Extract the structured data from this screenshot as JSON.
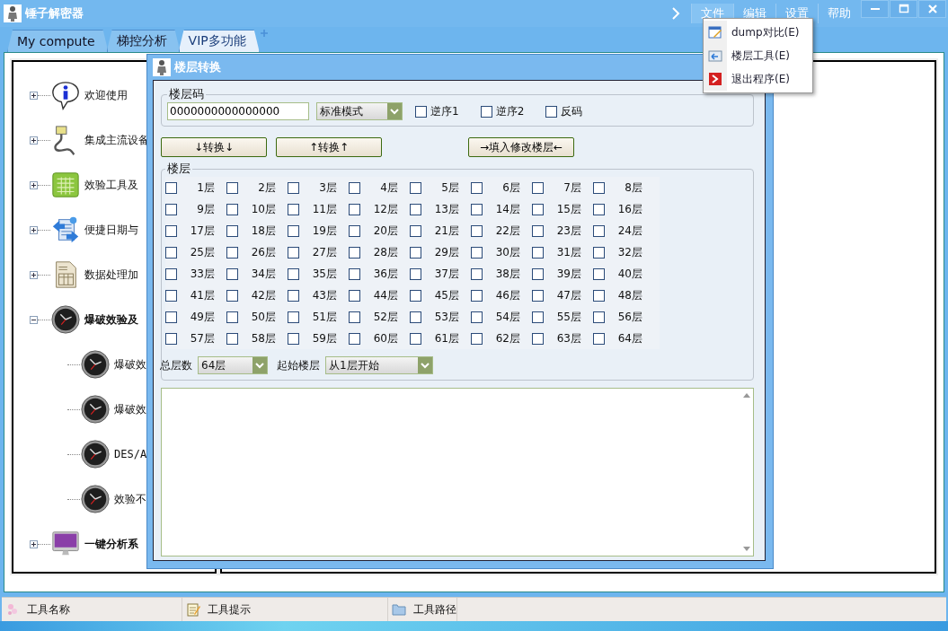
{
  "window": {
    "title": "锤子解密器"
  },
  "menu_bar": [
    {
      "label": "文件",
      "selected": true
    },
    {
      "label": "编辑",
      "selected": false
    },
    {
      "label": "设置",
      "selected": false
    },
    {
      "label": "帮助",
      "selected": false
    }
  ],
  "file_menu": [
    {
      "label": "dump对比(E)",
      "kind": "edit"
    },
    {
      "label": "楼层工具(E)",
      "kind": "tool"
    },
    {
      "label": "退出程序(E)",
      "kind": "exit"
    }
  ],
  "tabs": [
    {
      "label": "My compute",
      "selected": false
    },
    {
      "label": "梯控分析",
      "selected": false
    },
    {
      "label": "VIP多功能",
      "selected": true
    }
  ],
  "tree": [
    {
      "label": "欢迎使用",
      "kind": "info",
      "bold": false,
      "expanded": false
    },
    {
      "label": "集成主流设备",
      "kind": "cable",
      "bold": false,
      "expanded": false
    },
    {
      "label": "效验工具及",
      "kind": "sheet",
      "bold": false,
      "expanded": false
    },
    {
      "label": "便捷日期与",
      "kind": "doc",
      "bold": false,
      "expanded": false
    },
    {
      "label": "数据处理加",
      "kind": "table",
      "bold": false,
      "expanded": false
    },
    {
      "label": "爆破效验及",
      "kind": "clock",
      "bold": true,
      "expanded": true,
      "children": [
        {
          "label": "爆破效",
          "kind": "clock",
          "mono": false
        },
        {
          "label": "爆破效",
          "kind": "clock",
          "mono": false
        },
        {
          "label": "DES/A",
          "kind": "clock",
          "mono": true
        },
        {
          "label": "效验不",
          "kind": "clock",
          "mono": false
        }
      ]
    },
    {
      "label": "一键分析系",
      "kind": "monitor",
      "bold": true,
      "expanded": false
    }
  ],
  "dialog": {
    "title": "楼层转换",
    "code_group": {
      "title": "楼层码",
      "value": "0000000000000000",
      "mode": "标准模式",
      "options": [
        {
          "label": "逆序1",
          "checked": false
        },
        {
          "label": "逆序2",
          "checked": false
        },
        {
          "label": "反码",
          "checked": false
        }
      ]
    },
    "buttons": [
      "↓转换↓",
      "↑转换↑",
      "→填入修改楼层←"
    ],
    "floor_group": {
      "title": "楼层",
      "floors": [
        {
          "label": "1层",
          "checked": false
        },
        {
          "label": "2层",
          "checked": false
        },
        {
          "label": "3层",
          "checked": false
        },
        {
          "label": "4层",
          "checked": false
        },
        {
          "label": "5层",
          "checked": false
        },
        {
          "label": "6层",
          "checked": false
        },
        {
          "label": "7层",
          "checked": false
        },
        {
          "label": "8层",
          "checked": false
        },
        {
          "label": "9层",
          "checked": false
        },
        {
          "label": "10层",
          "checked": false
        },
        {
          "label": "11层",
          "checked": false
        },
        {
          "label": "12层",
          "checked": false
        },
        {
          "label": "13层",
          "checked": false
        },
        {
          "label": "14层",
          "checked": false
        },
        {
          "label": "15层",
          "checked": false
        },
        {
          "label": "16层",
          "checked": false
        },
        {
          "label": "17层",
          "checked": false
        },
        {
          "label": "18层",
          "checked": false
        },
        {
          "label": "19层",
          "checked": false
        },
        {
          "label": "20层",
          "checked": false
        },
        {
          "label": "21层",
          "checked": false
        },
        {
          "label": "22层",
          "checked": false
        },
        {
          "label": "23层",
          "checked": false
        },
        {
          "label": "24层",
          "checked": false
        },
        {
          "label": "25层",
          "checked": false
        },
        {
          "label": "26层",
          "checked": false
        },
        {
          "label": "27层",
          "checked": false
        },
        {
          "label": "28层",
          "checked": false
        },
        {
          "label": "29层",
          "checked": false
        },
        {
          "label": "30层",
          "checked": false
        },
        {
          "label": "31层",
          "checked": false
        },
        {
          "label": "32层",
          "checked": false
        },
        {
          "label": "33层",
          "checked": false
        },
        {
          "label": "34层",
          "checked": false
        },
        {
          "label": "35层",
          "checked": false
        },
        {
          "label": "36层",
          "checked": false
        },
        {
          "label": "37层",
          "checked": false
        },
        {
          "label": "38层",
          "checked": false
        },
        {
          "label": "39层",
          "checked": false
        },
        {
          "label": "40层",
          "checked": false
        },
        {
          "label": "41层",
          "checked": false
        },
        {
          "label": "42层",
          "checked": false
        },
        {
          "label": "43层",
          "checked": false
        },
        {
          "label": "44层",
          "checked": false
        },
        {
          "label": "45层",
          "checked": false
        },
        {
          "label": "46层",
          "checked": false
        },
        {
          "label": "47层",
          "checked": false
        },
        {
          "label": "48层",
          "checked": false
        },
        {
          "label": "49层",
          "checked": false
        },
        {
          "label": "50层",
          "checked": false
        },
        {
          "label": "51层",
          "checked": false
        },
        {
          "label": "52层",
          "checked": false
        },
        {
          "label": "53层",
          "checked": false
        },
        {
          "label": "54层",
          "checked": false
        },
        {
          "label": "55层",
          "checked": false
        },
        {
          "label": "56层",
          "checked": false
        },
        {
          "label": "57层",
          "checked": false
        },
        {
          "label": "58层",
          "checked": false
        },
        {
          "label": "59层",
          "checked": false
        },
        {
          "label": "60层",
          "checked": false
        },
        {
          "label": "61层",
          "checked": false
        },
        {
          "label": "62层",
          "checked": false
        },
        {
          "label": "63层",
          "checked": false
        },
        {
          "label": "64层",
          "checked": false
        }
      ],
      "total_label": "总层数",
      "total_value": "64层",
      "start_label": "起始楼层",
      "start_value": "从1层开始"
    }
  },
  "status_bar": [
    {
      "label": "工具名称",
      "kind": "flower"
    },
    {
      "label": "工具提示",
      "kind": "note"
    },
    {
      "label": "工具路径",
      "kind": "folder"
    }
  ]
}
